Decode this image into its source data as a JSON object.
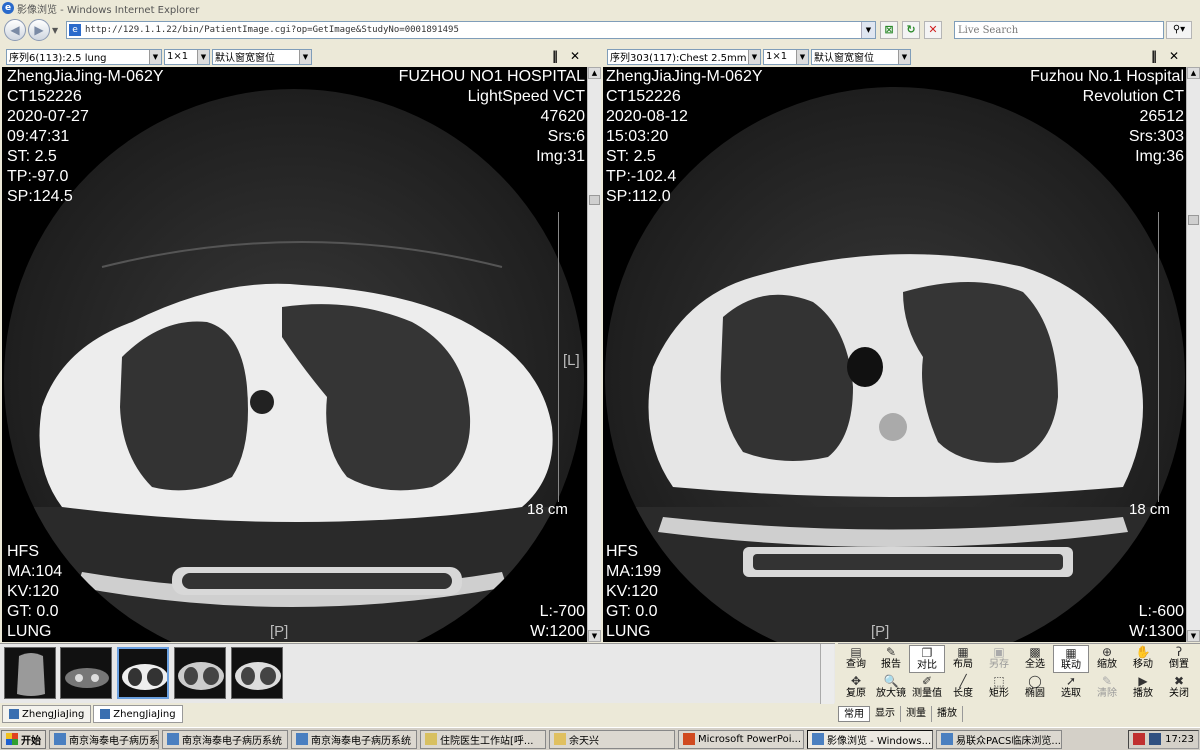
{
  "window": {
    "title": "影像浏览 - Windows Internet Explorer"
  },
  "address": {
    "url": "http://129.1.1.22/bin/PatientImage.cgi?op=GetImage&StudyNo=0001891495",
    "search_placeholder": "Live Search"
  },
  "viewers": [
    {
      "series_select": "序列6(113):2.5 lung",
      "layout_select": "1×1",
      "window_select": "默认窗宽窗位",
      "top_left": [
        "ZhengJiaJing-M-062Y",
        "CT152226",
        "2020-07-27",
        "09:47:31",
        "ST:  2.5",
        "TP:-97.0",
        "SP:124.5"
      ],
      "top_right": [
        "FUZHOU NO1  HOSPITAL",
        "LightSpeed VCT",
        "47620",
        "Srs:6",
        "Img:31"
      ],
      "bottom_left": [
        "HFS",
        "MA:104",
        "KV:120",
        "GT:  0.0",
        "LUNG"
      ],
      "bottom_right": [
        "L:-700",
        "W:1200"
      ],
      "scale": "18 cm",
      "orientation_right": "[L]",
      "orientation_bottom": "[P]"
    },
    {
      "series_select": "序列303(117):Chest 2.5mm",
      "layout_select": "1×1",
      "window_select": "默认窗宽窗位",
      "top_left": [
        "ZhengJiaJing-M-062Y",
        "CT152226",
        "2020-08-12",
        "15:03:20",
        "ST:  2.5",
        "TP:-102.4",
        "SP:112.0"
      ],
      "top_right": [
        "Fuzhou No.1 Hospital",
        "Revolution CT",
        "26512",
        "Srs:303",
        "Img:36"
      ],
      "bottom_left": [
        "HFS",
        "MA:199",
        "KV:120",
        "GT:  0.0",
        "LUNG"
      ],
      "bottom_right": [
        "L:-600",
        "W:1300"
      ],
      "scale": "18 cm",
      "orientation_right": "",
      "orientation_bottom": "[P]"
    }
  ],
  "tools_row1": [
    "查询",
    "报告",
    "对比",
    "布局",
    "另存",
    "全选",
    "联动",
    "缩放",
    "移动",
    "倒置"
  ],
  "tools_row2": [
    "复原",
    "放大镜",
    "测量值",
    "长度",
    "矩形",
    "椭圆",
    "选取",
    "清除",
    "播放",
    "关闭"
  ],
  "tool_tabs": [
    "常用",
    "显示",
    "测量",
    "播放"
  ],
  "patient_tabs": [
    "ZhengJiaJing",
    "ZhengJiaJing"
  ],
  "taskbar": {
    "start": "开始",
    "tasks": [
      "南京海泰电子病历系统",
      "南京海泰电子病历系统",
      "南京海泰电子病历系统",
      "住院医生工作站[呼...",
      "余天兴",
      "Microsoft PowerPoi...",
      "影像浏览 - Windows...",
      "易联众PACS临床浏览..."
    ],
    "clock": "17:23"
  }
}
